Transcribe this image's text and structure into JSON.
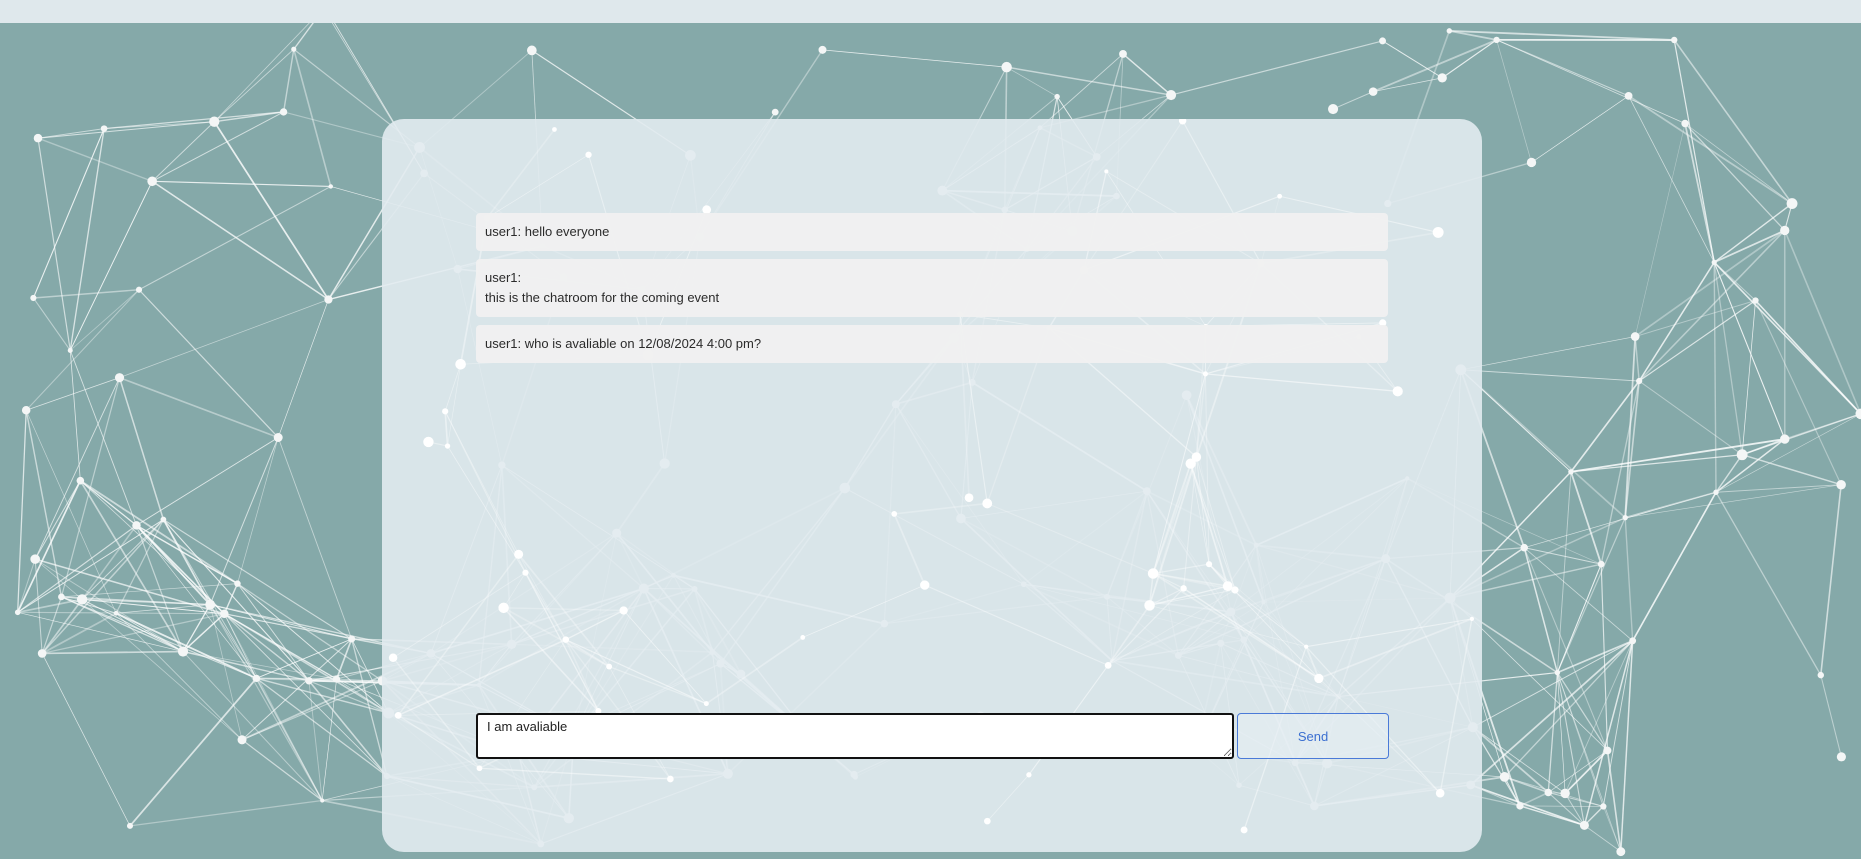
{
  "page": {
    "background_color": "#85a9a9",
    "panel_color": "#e2ebf0"
  },
  "chat": {
    "messages": [
      {
        "text": "user1: hello everyone"
      },
      {
        "text": "user1:\nthis is the chatroom for the coming event"
      },
      {
        "text": "user1: who is avaliable on 12/08/2024 4:00 pm?"
      }
    ],
    "composer": {
      "value": "I am avaliable",
      "send_label": "Send"
    }
  }
}
